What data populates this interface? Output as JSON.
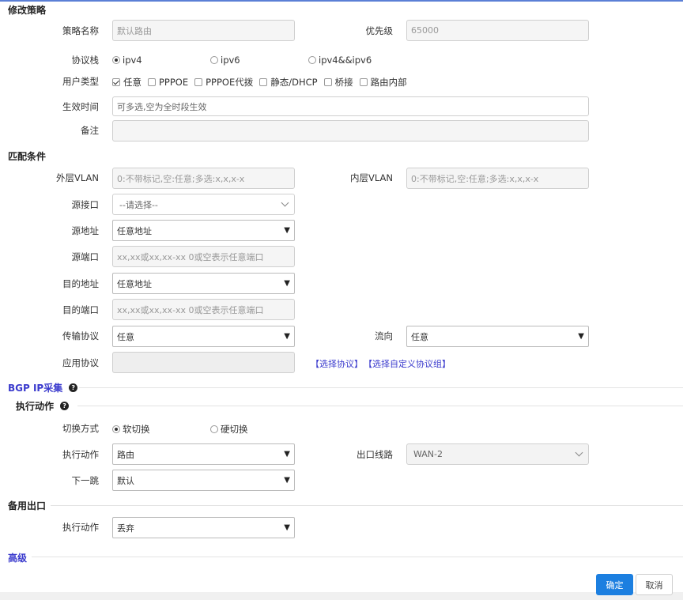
{
  "policy": {
    "section_title": "修改策略",
    "name_label": "策略名称",
    "name_value": "默认路由",
    "priority_label": "优先级",
    "priority_value": "65000",
    "stack_label": "协议栈",
    "stack_options": [
      "ipv4",
      "ipv6",
      "ipv4&&ipv6"
    ],
    "stack_selected": "ipv4",
    "user_type_label": "用户类型",
    "user_types": [
      {
        "label": "任意",
        "checked": true
      },
      {
        "label": "PPPOE",
        "checked": false
      },
      {
        "label": "PPPOE代拨",
        "checked": false
      },
      {
        "label": "静态/DHCP",
        "checked": false
      },
      {
        "label": "桥接",
        "checked": false
      },
      {
        "label": "路由内部",
        "checked": false
      }
    ],
    "time_label": "生效时间",
    "time_placeholder": "可多选,空为全时段生效",
    "remark_label": "备注",
    "remark_value": ""
  },
  "match": {
    "section_title": "匹配条件",
    "outer_vlan_label": "外层VLAN",
    "outer_vlan_placeholder": "0:不带标记,空:任意;多选:x,x,x-x",
    "inner_vlan_label": "内层VLAN",
    "inner_vlan_placeholder": "0:不带标记,空:任意;多选:x,x,x-x",
    "src_iface_label": "源接口",
    "src_iface_value": "--请选择--",
    "src_addr_label": "源地址",
    "src_addr_value": "任意地址",
    "src_port_label": "源端口",
    "src_port_placeholder": "xx,xx或xx,xx-xx 0或空表示任意端口",
    "dst_addr_label": "目的地址",
    "dst_addr_value": "任意地址",
    "dst_port_label": "目的端口",
    "dst_port_placeholder": "xx,xx或xx,xx-xx 0或空表示任意端口",
    "transport_label": "传输协议",
    "transport_value": "任意",
    "direction_label": "流向",
    "direction_value": "任意",
    "app_label": "应用协议",
    "app_value": "",
    "select_protocol_link": "【选择协议】",
    "select_custom_link": "【选择自定义协议组】"
  },
  "bgp": {
    "section_title": "BGP IP采集"
  },
  "action": {
    "section_title": "执行动作",
    "switch_label": "切换方式",
    "switch_options": [
      "软切换",
      "硬切换"
    ],
    "switch_selected": "软切换",
    "exec_label": "执行动作",
    "exec_value": "路由",
    "exit_label": "出口线路",
    "exit_value": "WAN-2",
    "nexthop_label": "下一跳",
    "nexthop_value": "默认"
  },
  "backup": {
    "section_title": "备用出口",
    "exec_label": "执行动作",
    "exec_value": "丢弃"
  },
  "advanced": {
    "section_title": "高级"
  },
  "buttons": {
    "confirm": "确定",
    "cancel": "取消"
  },
  "colors": {
    "primary": "#1c7fe0",
    "link": "#3a3acd"
  }
}
